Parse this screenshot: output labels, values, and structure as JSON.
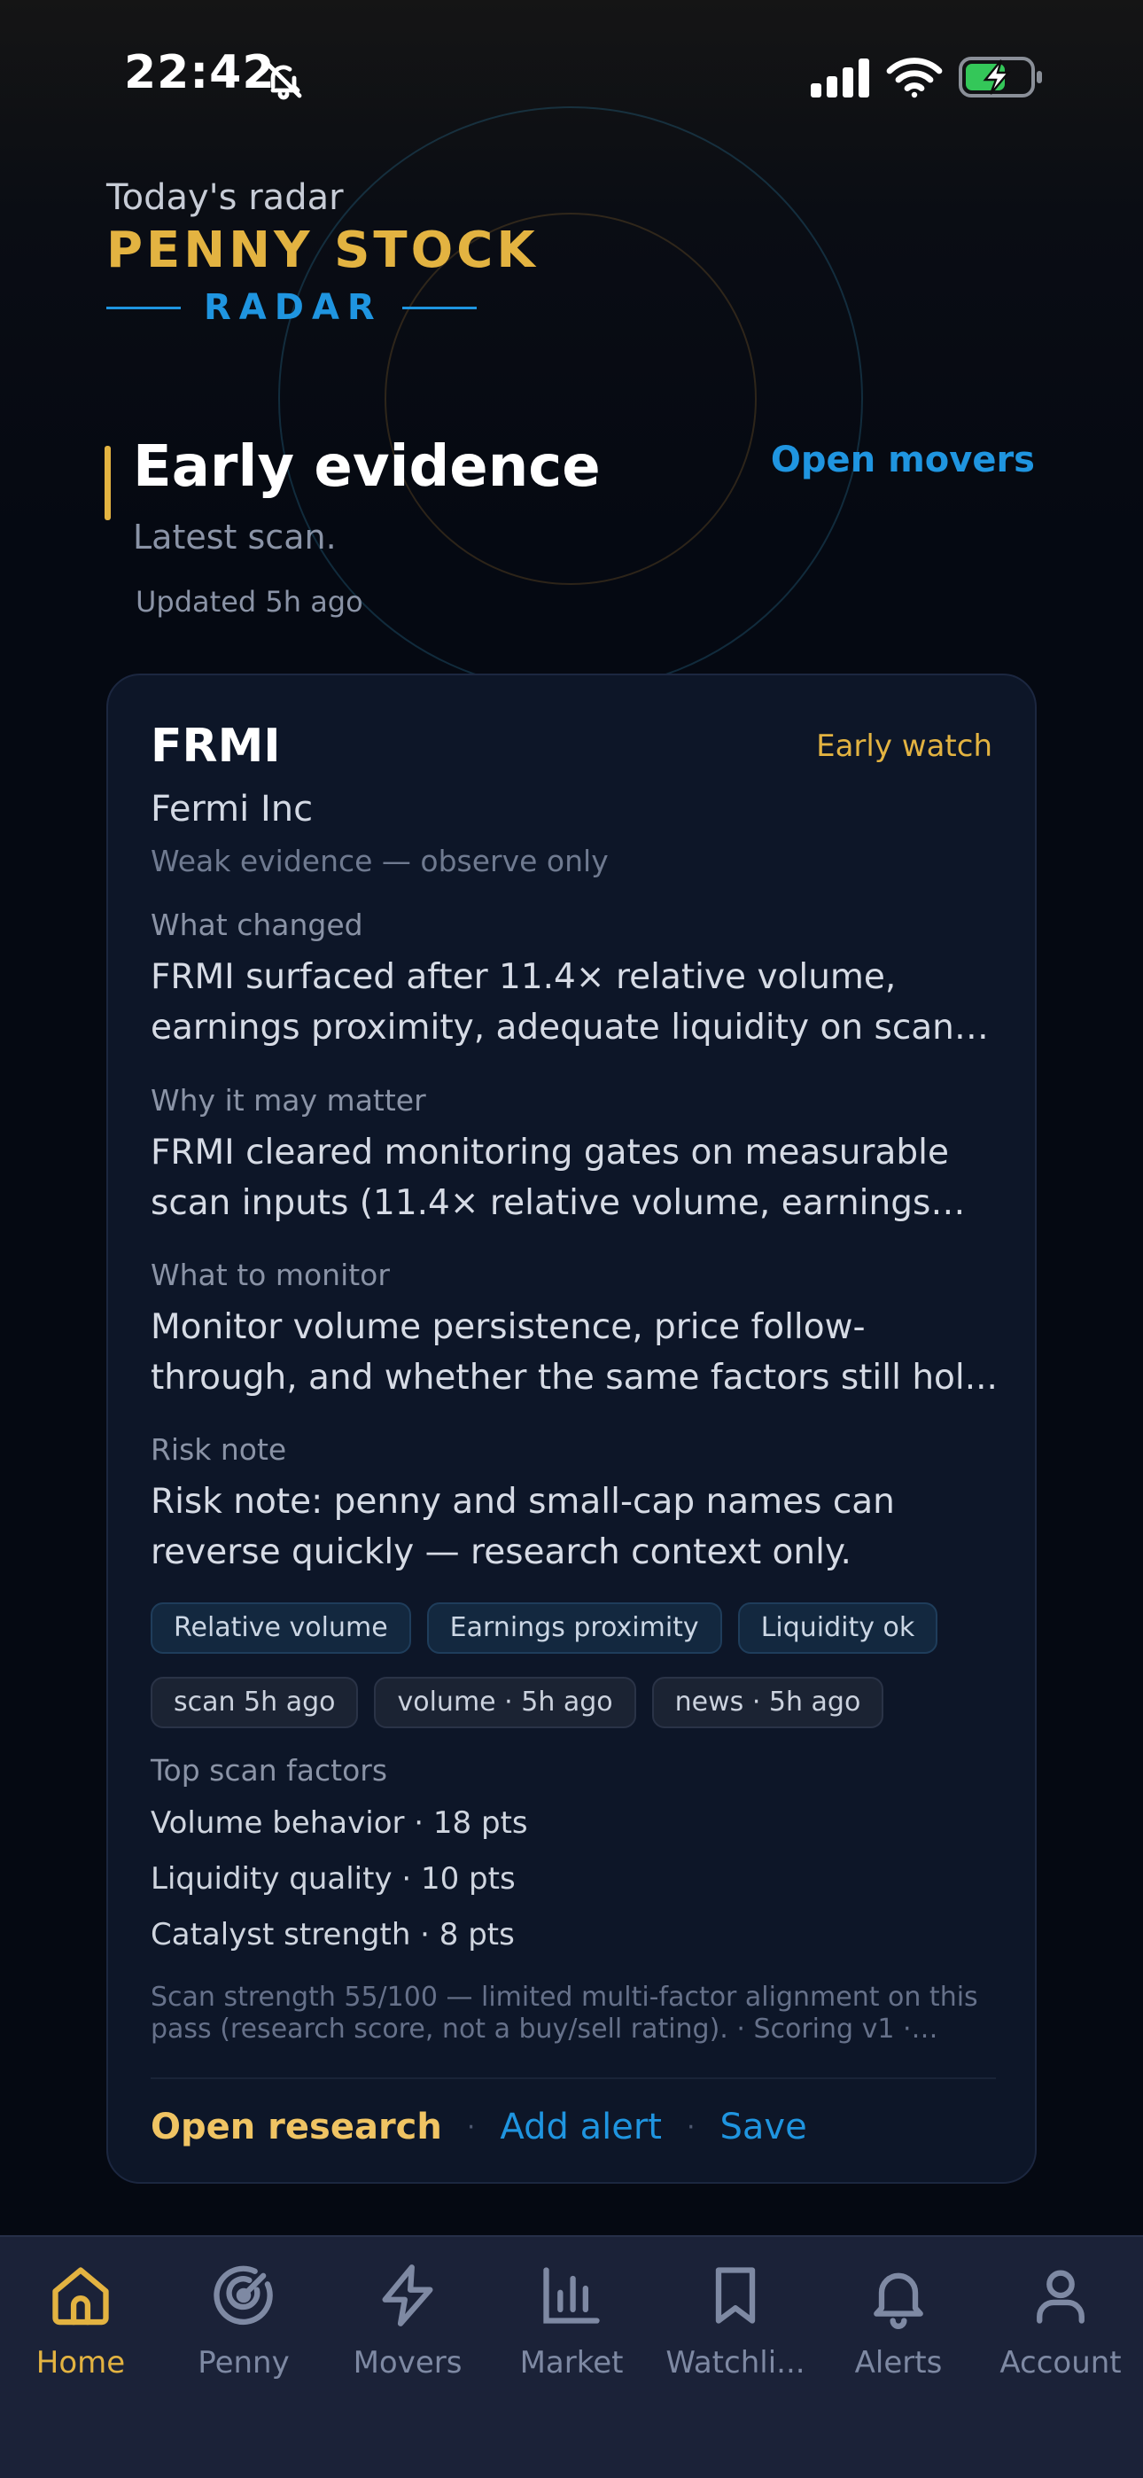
{
  "status_bar": {
    "time": "22:42"
  },
  "header": {
    "kicker": "Today's radar",
    "brand_title": "PENNY STOCK",
    "brand_sub": "RADAR"
  },
  "section": {
    "title": "Early evidence",
    "subtitle": "Latest scan.",
    "updated": "Updated 5h ago",
    "open_movers_label": "Open movers"
  },
  "card": {
    "ticker": "FRMI",
    "stage_badge": "Early watch",
    "company": "Fermi Inc",
    "evidence_level": "Weak evidence — observe only",
    "what_changed": {
      "label": "What changed",
      "text": "FRMI surfaced after 11.4× relative volume, earnings proximity, adequate liquidity on scan r..."
    },
    "why_matter": {
      "label": "Why it may matter",
      "text": "FRMI cleared monitoring gates on measurable scan inputs (11.4× relative volume, earnings pro..."
    },
    "what_monitor": {
      "label": "What to monitor",
      "text": "Monitor volume persistence, price follow-through, and whether the same factors still hol..."
    },
    "risk_note": {
      "label": "Risk note",
      "text": "Risk note: penny and small-cap names can reverse quickly — research context only."
    },
    "factor_chips": [
      "Relative volume",
      "Earnings proximity",
      "Liquidity ok"
    ],
    "freshness_chips": [
      "scan 5h ago",
      "volume · 5h ago",
      "news · 5h ago"
    ],
    "top_factors_label": "Top scan factors",
    "top_factors": [
      "Volume behavior · 18 pts",
      "Liquidity quality · 10 pts",
      "Catalyst strength · 8 pts"
    ],
    "disclaimer": "Scan strength 55/100 — limited multi-factor alignment on this pass (research score, not a buy/sell rating). · Scoring v1 · Rules-...",
    "actions": {
      "open_research": "Open research",
      "add_alert": "Add alert",
      "save": "Save",
      "separator": "·"
    }
  },
  "tab_bar": {
    "tabs": [
      {
        "label": "Home",
        "icon": "home-icon",
        "active": true
      },
      {
        "label": "Penny",
        "icon": "radar-icon",
        "active": false
      },
      {
        "label": "Movers",
        "icon": "lightning-icon",
        "active": false
      },
      {
        "label": "Market",
        "icon": "bar-chart-icon",
        "active": false
      },
      {
        "label": "Watchli...",
        "icon": "bookmark-icon",
        "active": false
      },
      {
        "label": "Alerts",
        "icon": "bell-icon",
        "active": false
      },
      {
        "label": "Account",
        "icon": "person-icon",
        "active": false
      }
    ]
  },
  "colors": {
    "accent_gold": "#e3b341",
    "accent_blue": "#1f95e0",
    "background": "#050912",
    "card": "#0d1628",
    "tab_bar": "#1b2238"
  }
}
